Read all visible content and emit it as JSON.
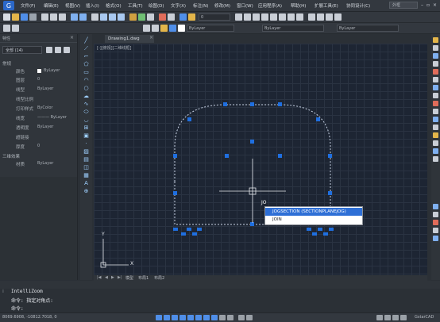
{
  "app": {
    "menus": [
      "文件(F)",
      "编辑(E)",
      "视图(V)",
      "插入(I)",
      "格式(O)",
      "工具(T)",
      "绘图(D)",
      "文字(X)",
      "标注(N)",
      "修改(M)",
      "窗口(W)",
      "应用程序(A)",
      "帮助(H)",
      "扩展工具(E)",
      "协同设计(C)"
    ],
    "search_placeholder": "外框",
    "colors": {
      "accent": "#2e6fd6",
      "entity": "#1f6fe0",
      "canvas": "#1d2533"
    }
  },
  "toolbar": {
    "layer_combo": "0",
    "color_combo": "ByLayer",
    "linetype_combo": "ByLayer",
    "lineweight_combo": "ByLayer"
  },
  "properties": {
    "title": "特性",
    "selection": "全部 (14)",
    "general_header": "常规",
    "rows": [
      {
        "label": "颜色",
        "value": "ByLayer"
      },
      {
        "label": "图层",
        "value": "0"
      },
      {
        "label": "线型",
        "value": "ByLayer"
      },
      {
        "label": "线型比例",
        "value": ""
      },
      {
        "label": "打印样式",
        "value": "ByColor"
      },
      {
        "label": "线宽",
        "value": "——— ByLayer"
      },
      {
        "label": "透明度",
        "value": "ByLayer"
      },
      {
        "label": "超链接",
        "value": ""
      },
      {
        "label": "厚度",
        "value": "0"
      }
    ],
    "three_d_header": "三维效果",
    "material": {
      "label": "材质",
      "value": "ByLayer"
    }
  },
  "drawing": {
    "tab_label": "Drawing1.dwg",
    "viewport_label": "[-][俯视][二维线框]",
    "axis_y": "Y",
    "axis_x": "X"
  },
  "autocomplete": {
    "typed": "JO",
    "items": [
      "JOGSECTION (SECTIONPLANEJOG)",
      "JOIN"
    ]
  },
  "layout_tabs": [
    "模型",
    "布局1",
    "布局2"
  ],
  "command": {
    "history": "IntelliZoom",
    "prompt1": "命令: 指定对角点:",
    "prompt2": "命令:"
  },
  "status": {
    "coords": "8069.6908, -10812.7018, 0",
    "brand": "GstarCAD"
  }
}
